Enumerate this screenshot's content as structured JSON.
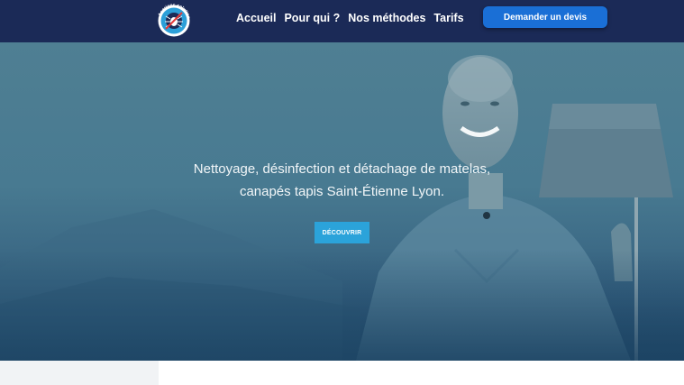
{
  "header": {
    "logo_text": "Acariens solution",
    "nav": [
      {
        "label": "Accueil"
      },
      {
        "label": "Pour qui ?"
      },
      {
        "label": "Nos méthodes"
      },
      {
        "label": "Tarifs"
      }
    ],
    "cta_label": "Demander un devis"
  },
  "hero": {
    "line1": "Nettoyage, désinfection et détachage de matelas,",
    "line2": "canapés tapis Saint-Étienne Lyon.",
    "button_label": "DÉCOUVRIR"
  },
  "colors": {
    "header_bg": "#1b2a57",
    "cta_bg": "#1a6fd6",
    "hero_button_bg": "#2ba3da"
  }
}
